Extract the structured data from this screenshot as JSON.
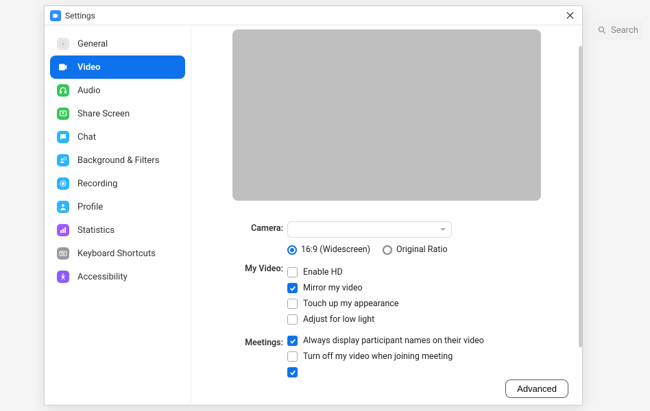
{
  "window": {
    "title": "Settings"
  },
  "search": {
    "placeholder": "Search"
  },
  "sidebar": {
    "items": [
      {
        "label": "General",
        "icon": "gear",
        "bg": "#e8e8e8",
        "fg": "#bbb",
        "active": false
      },
      {
        "label": "Video",
        "icon": "video",
        "bg": "#ffffff",
        "fg": "#0e72ed",
        "active": true
      },
      {
        "label": "Audio",
        "icon": "headphones",
        "bg": "#34c759",
        "fg": "#fff",
        "active": false
      },
      {
        "label": "Share Screen",
        "icon": "share",
        "bg": "#34c759",
        "fg": "#fff",
        "active": false
      },
      {
        "label": "Chat",
        "icon": "chat",
        "bg": "#2db4ff",
        "fg": "#fff",
        "active": false
      },
      {
        "label": "Background & Filters",
        "icon": "bg",
        "bg": "#2db4ff",
        "fg": "#fff",
        "active": false
      },
      {
        "label": "Recording",
        "icon": "record",
        "bg": "#2db4ff",
        "fg": "#fff",
        "active": false
      },
      {
        "label": "Profile",
        "icon": "profile",
        "bg": "#2db4ff",
        "fg": "#fff",
        "active": false
      },
      {
        "label": "Statistics",
        "icon": "stats",
        "bg": "#9b5cff",
        "fg": "#fff",
        "active": false
      },
      {
        "label": "Keyboard Shortcuts",
        "icon": "keyboard",
        "bg": "#9a9aa0",
        "fg": "#fff",
        "active": false
      },
      {
        "label": "Accessibility",
        "icon": "accessibility",
        "bg": "#8c5cff",
        "fg": "#fff",
        "active": false
      }
    ]
  },
  "video": {
    "camera_label": "Camera:",
    "myvideo_label": "My Video:",
    "meetings_label": "Meetings:",
    "ratio_169": "16:9 (Widescreen)",
    "ratio_orig": "Original Ratio",
    "enable_hd": "Enable HD",
    "mirror": "Mirror my video",
    "touch_up": "Touch up my appearance",
    "low_light": "Adjust for low light",
    "always_names": "Always display participant names on their video",
    "turn_off": "Turn off my video when joining meeting",
    "advanced": "Advanced"
  }
}
